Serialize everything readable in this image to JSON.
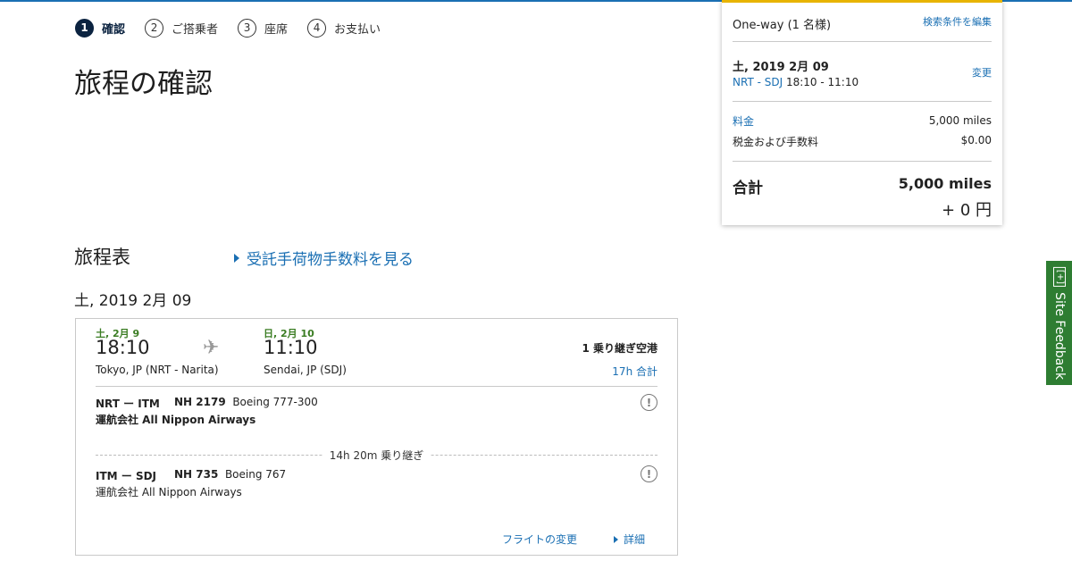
{
  "stepper": {
    "steps": [
      {
        "num": "1",
        "label": "確認"
      },
      {
        "num": "2",
        "label": "ご搭乗者"
      },
      {
        "num": "3",
        "label": "座席"
      },
      {
        "num": "4",
        "label": "お支払い"
      }
    ]
  },
  "page_title": "旅程の確認",
  "itinerary": {
    "section_title": "旅程表",
    "bag_fee_link": "受託手荷物手数料を見る",
    "date_heading": "土, 2019 2月 09",
    "card": {
      "departure_date": "土, 2月 9",
      "departure_time": "18:10",
      "departure_city": "Tokyo, JP (NRT - Narita)",
      "arrival_date": "日, 2月 10",
      "arrival_time": "11:10",
      "arrival_city": "Sendai, JP (SDJ)",
      "stops": "1 乗り継ぎ空港",
      "total_duration": "17h 合計",
      "segments": [
        {
          "route": "NRT ー ITM",
          "flight_no": "NH 2179",
          "aircraft": "Boeing 777-300",
          "operator": "運航会社 All Nippon Airways"
        },
        {
          "route": "ITM ー SDJ",
          "flight_no": "NH 735",
          "aircraft": "Boeing 767",
          "operator": "運航会社 All Nippon Airways"
        }
      ],
      "layover": "14h 20m 乗り継ぎ",
      "change_flight_link": "フライトの変更",
      "details_link": "詳細"
    }
  },
  "summary": {
    "trip_type": "One-way (1 名様)",
    "edit_search": "検索条件を編集",
    "date": "土, 2019 2月 09",
    "route_code": "NRT - SDJ",
    "route_time": "18:10 - 11:10",
    "change": "変更",
    "fare_label": "料金",
    "fare_value": "5,000 miles",
    "tax_label": "税金および手数料",
    "tax_value": "$0.00",
    "total_label": "合計",
    "total_miles": "5,000 miles",
    "total_yen": "+ 0 円"
  },
  "feedback_tab": {
    "icon": "[+]",
    "label": "Site Feedback"
  },
  "colors": {
    "link": "#1a6fb3",
    "date_green": "#3b7d23",
    "step_active": "#0b2340",
    "feedback_bg": "#2e7d32",
    "summary_accent": "#e8b400"
  }
}
